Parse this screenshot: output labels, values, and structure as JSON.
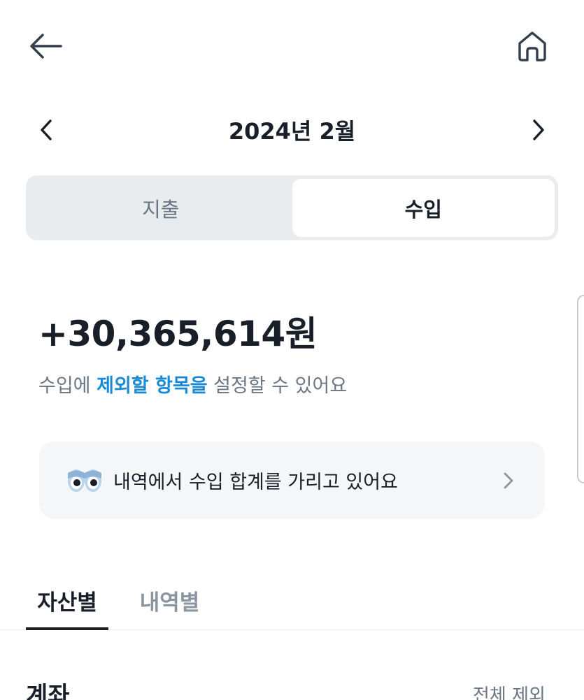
{
  "header": {
    "back_icon": "arrow-left-icon",
    "home_icon": "home-icon"
  },
  "month_nav": {
    "title": "2024년 2월",
    "prev_icon": "chevron-left-icon",
    "next_icon": "chevron-right-icon"
  },
  "segment": {
    "items": [
      {
        "label": "지출",
        "active": false
      },
      {
        "label": "수입",
        "active": true
      }
    ]
  },
  "summary": {
    "amount": "+30,365,614원",
    "exclude_prefix": "수입에 ",
    "exclude_link": "제외할 항목을",
    "exclude_suffix": " 설정할 수 있어요"
  },
  "hidden_notice": {
    "icon": "eyes-icon",
    "text": "내역에서 수입 합계를 가리고 있어요",
    "chevron_icon": "chevron-right-icon"
  },
  "tabs": [
    {
      "label": "자산별",
      "active": true
    },
    {
      "label": "내역별",
      "active": false
    }
  ],
  "section": {
    "title": "계좌",
    "action": "전체 제외"
  },
  "colors": {
    "text_primary": "#191f28",
    "text_secondary": "#6b7684",
    "link": "#1b8ad6",
    "segment_bg": "#e9ecef",
    "card_bg": "#f4f6f8"
  }
}
